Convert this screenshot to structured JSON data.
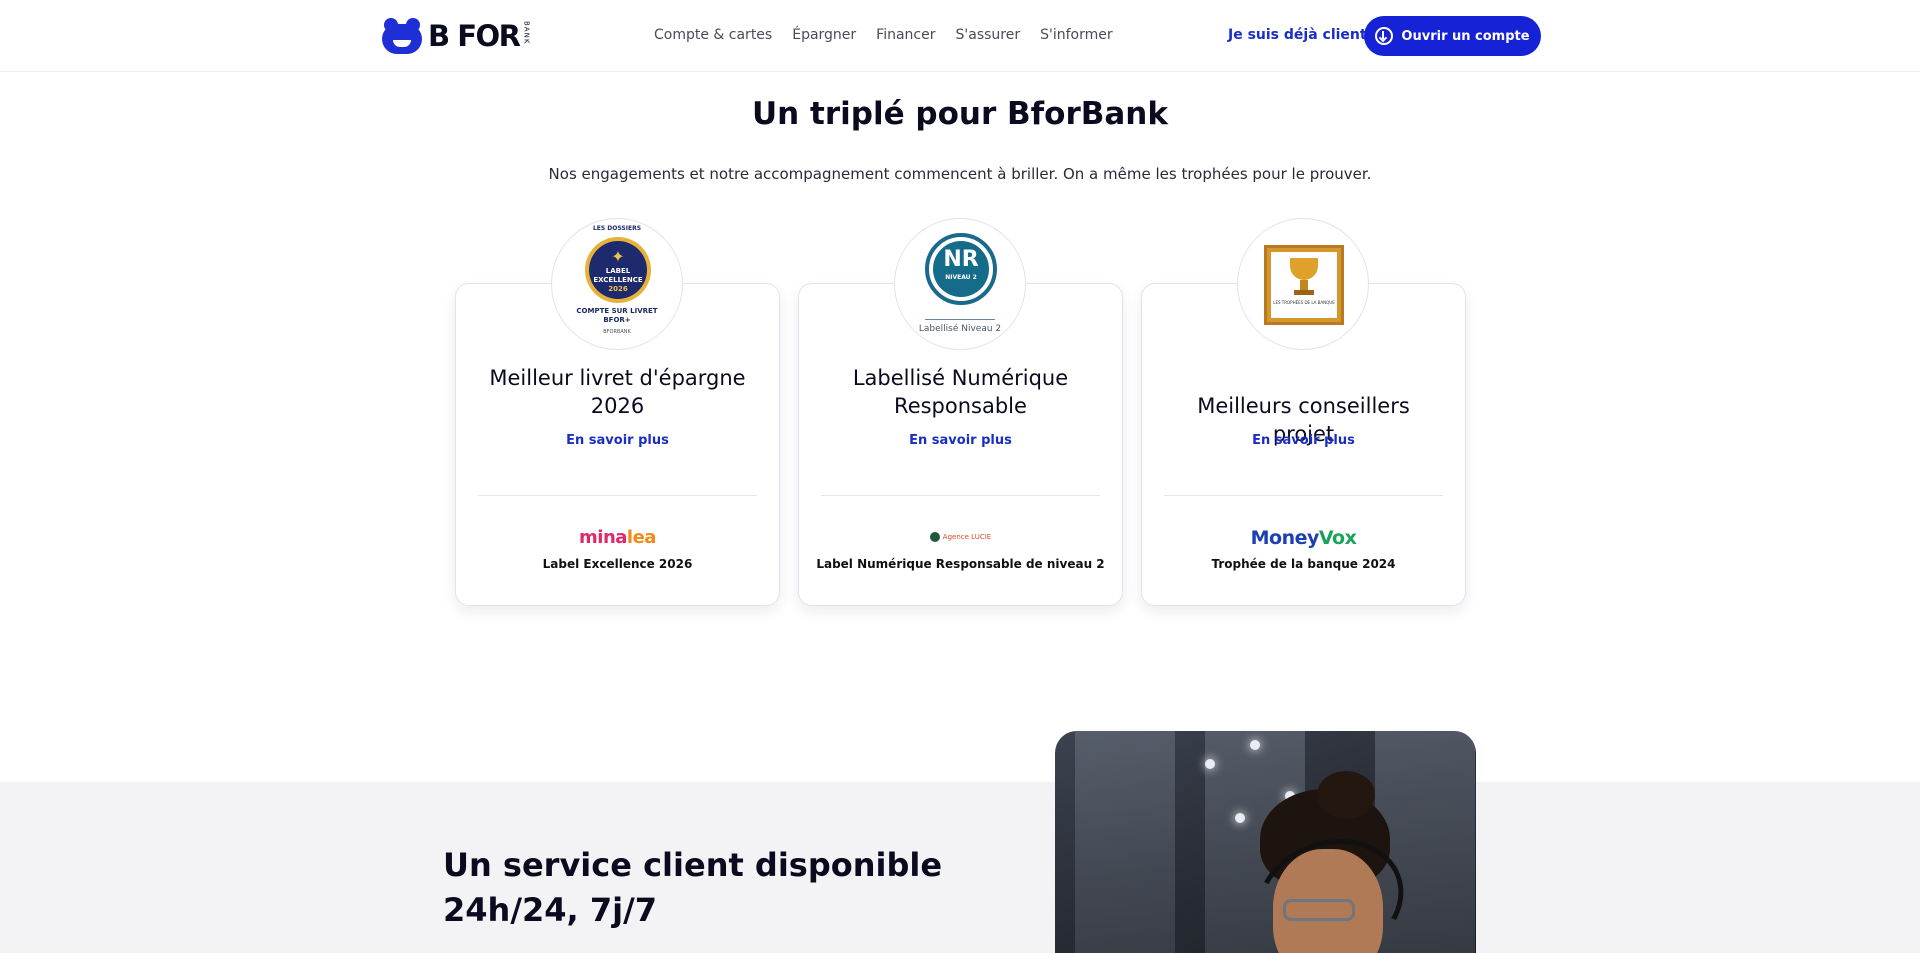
{
  "header": {
    "logo": {
      "text": "B FOR",
      "sub": "BANK"
    },
    "nav": [
      "Compte & cartes",
      "Épargner",
      "Financer",
      "S'assurer",
      "S'informer"
    ],
    "login_link": "Je suis déjà client",
    "open_account": "Ouvrir un compte",
    "accent_color": "#1622d6"
  },
  "awards": {
    "title": "Un triplé pour BforBank",
    "subtitle": "Nos engagements et notre accompagnement commencent à briller. On a même les trophées pour le prouver.",
    "cards": [
      {
        "title": "Meilleur livret d'épargne 2026",
        "more": "En savoir plus",
        "brand": "minalea",
        "desc": "Label Excellence 2026",
        "badge": {
          "top": "LES DOSSIERS",
          "label": "LABEL EXCELLENCE",
          "year": "2026",
          "bottom1": "COMPTE SUR LIVRET",
          "bottom2": "BFOR+",
          "tiny": "BFORBANK"
        }
      },
      {
        "title": "Labellisé Numérique Responsable",
        "more": "En savoir plus",
        "brand": "Agence LUCIE",
        "desc": "Label Numérique Responsable de niveau 2",
        "badge": {
          "mark": "NR",
          "level": "NIVEAU 2",
          "caption": "Labellisé Niveau 2"
        }
      },
      {
        "title": "Meilleurs conseillers projet",
        "more": "En savoir plus",
        "brand": "MoneyVox",
        "desc": "Trophée de la banque 2024",
        "badge": {
          "text": "LES TROPHÉES DE LA BANQUE"
        }
      }
    ]
  },
  "service": {
    "title": "Un service client disponible 24h/24, 7j/7"
  }
}
